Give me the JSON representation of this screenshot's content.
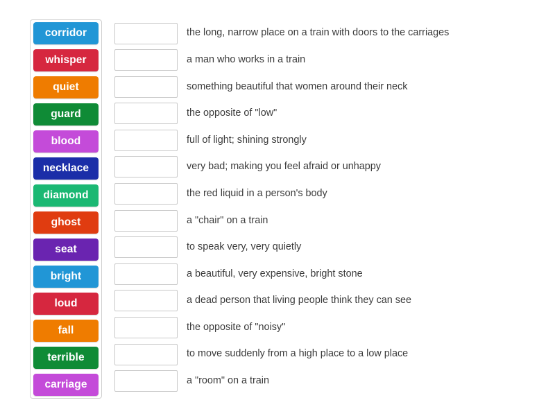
{
  "activity": {
    "type": "match-up-drag-and-drop",
    "word_bank_label": "word-bank",
    "tiles": [
      {
        "label": "corridor",
        "color": "#2196d6"
      },
      {
        "label": "whisper",
        "color": "#d6273f"
      },
      {
        "label": "quiet",
        "color": "#ef7c00"
      },
      {
        "label": "guard",
        "color": "#0f8b36"
      },
      {
        "label": "blood",
        "color": "#c44bd9"
      },
      {
        "label": "necklace",
        "color": "#1b2ea8"
      },
      {
        "label": "diamond",
        "color": "#1bb873"
      },
      {
        "label": "ghost",
        "color": "#e03c10"
      },
      {
        "label": "seat",
        "color": "#6a24b0"
      },
      {
        "label": "bright",
        "color": "#2196d6"
      },
      {
        "label": "loud",
        "color": "#d6273f"
      },
      {
        "label": "fall",
        "color": "#ef7c00"
      },
      {
        "label": "terrible",
        "color": "#0f8b36"
      },
      {
        "label": "carriage",
        "color": "#c44bd9"
      }
    ],
    "rows": [
      {
        "answer": "",
        "definition": "the long, narrow place on a train with doors to the carriages"
      },
      {
        "answer": "",
        "definition": "a man who works in a train"
      },
      {
        "answer": "",
        "definition": "something beautiful that women around their neck"
      },
      {
        "answer": "",
        "definition": "the opposite of \"low\""
      },
      {
        "answer": "",
        "definition": "full of light; shining strongly"
      },
      {
        "answer": "",
        "definition": "very bad; making you feel afraid or unhappy"
      },
      {
        "answer": "",
        "definition": "the red liquid in a person's body"
      },
      {
        "answer": "",
        "definition": "a \"chair\" on a train"
      },
      {
        "answer": "",
        "definition": "to speak very, very quietly"
      },
      {
        "answer": "",
        "definition": "a beautiful, very expensive, bright stone"
      },
      {
        "answer": "",
        "definition": "a dead person that living people think they can see"
      },
      {
        "answer": "",
        "definition": "the opposite of \"noisy\""
      },
      {
        "answer": "",
        "definition": "to move suddenly from a high place to a low place"
      },
      {
        "answer": "",
        "definition": "a \"room\" on a train"
      }
    ]
  }
}
